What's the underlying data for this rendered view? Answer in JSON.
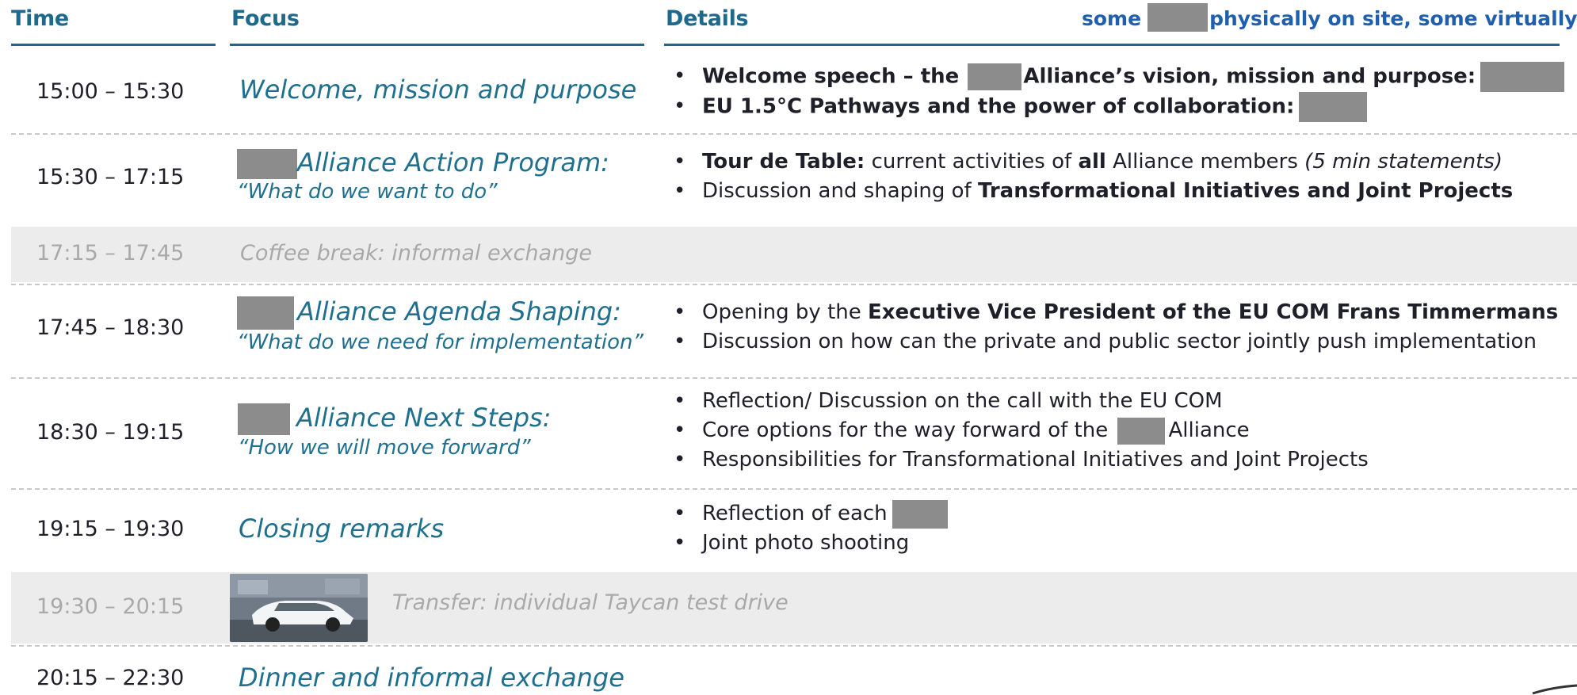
{
  "headers": {
    "time": "Time",
    "focus": "Focus",
    "details": "Details"
  },
  "note": {
    "before": "some",
    "after": "physically on site, some virtually"
  },
  "rows": [
    {
      "time_start": "15:00",
      "time_sep": " – ",
      "time_end": "15:30",
      "focus_title": "Welcome, mission and purpose",
      "details": [
        {
          "a": "Welcome speech – the ",
          "b": "Alliance’s vision, mission and purpose:"
        },
        {
          "a": "EU 1.5°C Pathways and the power of collaboration:"
        }
      ]
    },
    {
      "time_start": "15:30",
      "time_sep": " – ",
      "time_end": "17:15",
      "focus_title": "Alliance Action Program:",
      "focus_sub": "“What do we want to do”",
      "details": [
        {
          "a": "Tour de Table:",
          "b": " current activities of ",
          "c": "all",
          "d": " Alliance members ",
          "e": "(5 min statements)"
        },
        {
          "a": "Discussion and shaping of ",
          "b": "Transformational Initiatives and Joint Projects"
        }
      ]
    },
    {
      "time_start": "17:15",
      "time_sep": " – ",
      "time_end": "17:45",
      "focus_title": "Coffee break: informal exchange"
    },
    {
      "time_start": "17:45",
      "time_sep": " – ",
      "time_end": "18:30",
      "focus_title": "Alliance Agenda Shaping:",
      "focus_sub": "“What do we need for implementation”",
      "details": [
        {
          "a": "Opening by the ",
          "b": "Executive Vice President of the EU COM Frans Timmermans"
        },
        {
          "a": "Discussion on how can the private and public sector jointly push implementation"
        }
      ]
    },
    {
      "time_start": "18:30",
      "time_sep": " – ",
      "time_end": "19:15",
      "focus_title": "Alliance Next Steps:",
      "focus_sub": "“How we will move forward”",
      "details": [
        {
          "a": "Reflection/ Discussion on the call with the EU COM"
        },
        {
          "a": "Core options for the way forward of the ",
          "b": "Alliance"
        },
        {
          "a": "Responsibilities for Transformational Initiatives and Joint Projects"
        }
      ]
    },
    {
      "time_start": "19:15",
      "time_sep": " – ",
      "time_end": "19:30",
      "focus_title": "Closing remarks",
      "details": [
        {
          "a": "Reflection of each"
        },
        {
          "a": "Joint photo shooting"
        }
      ]
    },
    {
      "time_start": "19:30",
      "time_sep": " – ",
      "time_end": "20:15",
      "focus_title": "Transfer: individual Taycan test drive"
    },
    {
      "time_start": "20:15",
      "time_sep": " – ",
      "time_end": "22:30",
      "focus_title": "Dinner and informal exchange"
    }
  ]
}
